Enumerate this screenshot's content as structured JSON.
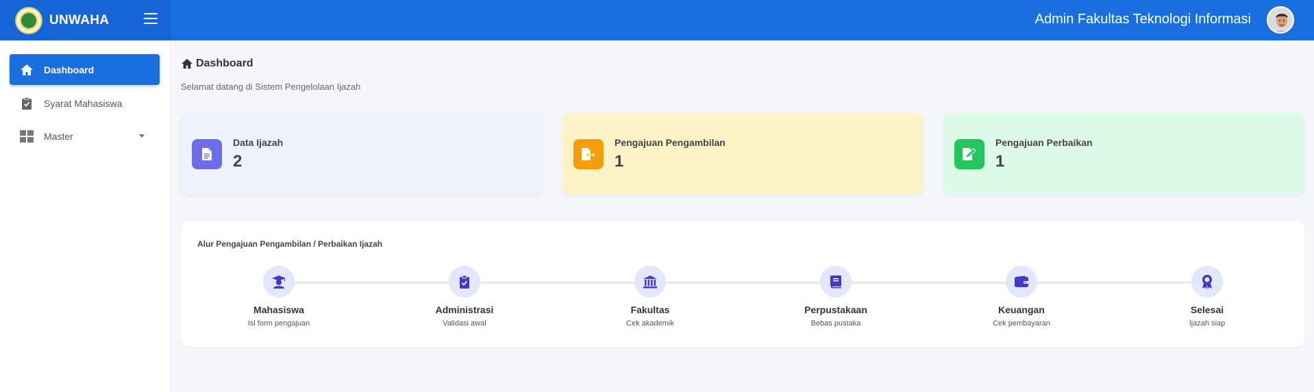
{
  "header": {
    "brand": "UNWAHA",
    "admin_name": "Admin Fakultas Teknologi Informasi"
  },
  "sidebar": {
    "items": [
      {
        "label": "Dashboard",
        "icon": "home-icon",
        "active": true
      },
      {
        "label": "Syarat Mahasiswa",
        "icon": "clipboard-check-icon",
        "active": false
      },
      {
        "label": "Master",
        "icon": "grid-icon",
        "active": false,
        "has_dropdown": true
      }
    ]
  },
  "main": {
    "title": "Dashboard",
    "subtitle": "Selamat datang di Sistem Pengelolaan Ijazah",
    "cards": [
      {
        "label": "Data Ijazah",
        "value": "2",
        "icon": "document-icon",
        "bg": "#eef2fd",
        "icon_bg": "#6b6ee8"
      },
      {
        "label": "Pengajuan Pengambilan",
        "value": "1",
        "icon": "file-export-icon",
        "bg": "#fef3c7",
        "icon_bg": "#f59e0b"
      },
      {
        "label": "Pengajuan Perbaikan",
        "value": "1",
        "icon": "file-edit-icon",
        "bg": "#dcfce7",
        "icon_bg": "#22c55e"
      }
    ],
    "flow": {
      "title": "Alur Pengajuan Pengambilan / Perbaikan Ijazah",
      "steps": [
        {
          "name": "Mahasiswa",
          "desc": "Isi form pengajuan",
          "icon": "graduate-icon"
        },
        {
          "name": "Administrasi",
          "desc": "Validasi awal",
          "icon": "clipboard-check-icon"
        },
        {
          "name": "Fakultas",
          "desc": "Cek akademik",
          "icon": "university-icon"
        },
        {
          "name": "Perpustakaan",
          "desc": "Bebas pustaka",
          "icon": "book-icon"
        },
        {
          "name": "Keuangan",
          "desc": "Cek pembayaran",
          "icon": "wallet-icon"
        },
        {
          "name": "Selesai",
          "desc": "Ijazah siap",
          "icon": "award-icon"
        }
      ]
    }
  },
  "colors": {
    "primary": "#1a6fe0",
    "step_icon": "#4338ca",
    "step_circle": "#e3e7fb"
  }
}
